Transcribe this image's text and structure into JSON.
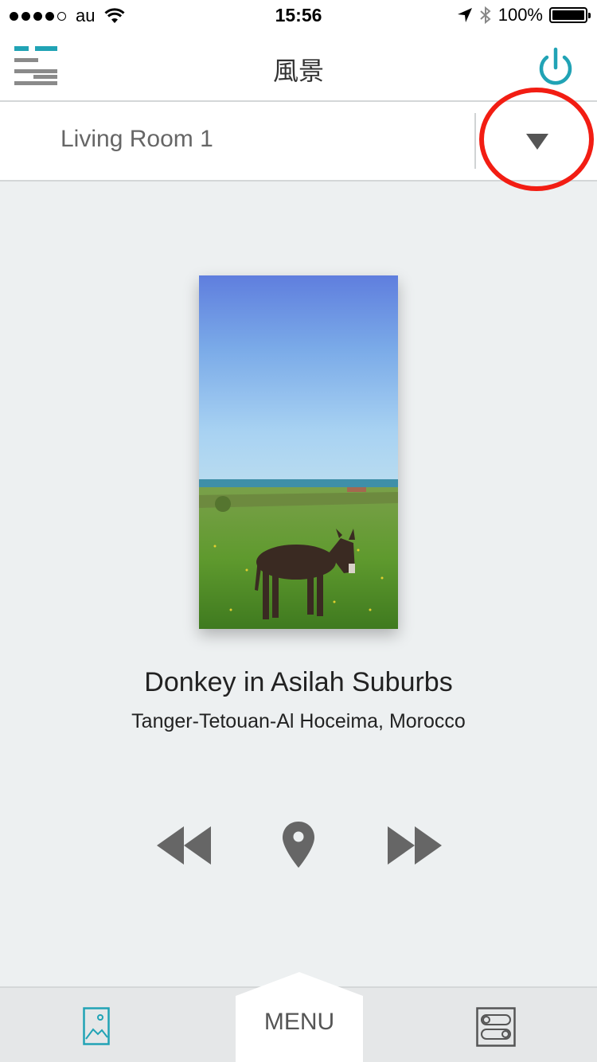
{
  "status": {
    "carrier": "au",
    "time": "15:56",
    "battery": "100%"
  },
  "header": {
    "title": "風景"
  },
  "room": {
    "name": "Living Room 1"
  },
  "photo": {
    "title": "Donkey in Asilah Suburbs",
    "location": "Tanger-Tetouan-Al Hoceima, Morocco"
  },
  "tabbar": {
    "menu_label": "MENU"
  },
  "colors": {
    "accent": "#21a3b5",
    "highlight": "#f21d13",
    "background": "#edf0f1"
  },
  "icons": [
    "menu-icon",
    "power-icon",
    "dropdown-arrow-icon",
    "rewind-icon",
    "location-pin-icon",
    "fast-forward-icon",
    "photo-icon",
    "settings-toggle-icon",
    "wifi-icon",
    "location-arrow-icon",
    "bluetooth-icon",
    "battery-icon"
  ]
}
